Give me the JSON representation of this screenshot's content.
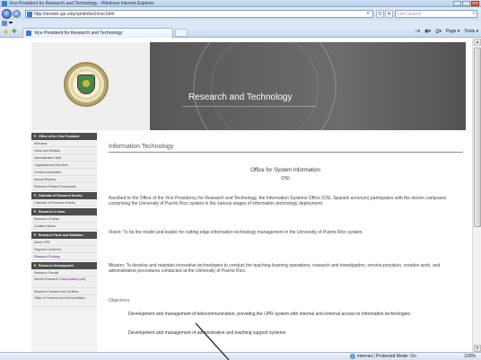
{
  "window": {
    "title": "Vice President for Research and Technology - Windows Internet Explorer"
  },
  "addressbar": {
    "url": "http://ierweb.upr.edu/vprit/eltech/osi.html",
    "back_icon": "back-arrow-icon",
    "forward_icon": "forward-arrow-icon"
  },
  "search": {
    "placeholder": "Live Search"
  },
  "tabs": [
    {
      "label": "Vice President for Research and Technology"
    }
  ],
  "toolbar": {
    "home": "▾",
    "feeds": "▾",
    "print": "▾",
    "page": "Page ▾",
    "tools": "Tools ▾"
  },
  "banner": {
    "title": "Research and Technology"
  },
  "sidebar": {
    "sections": [
      {
        "header": "Office of the Vice President",
        "items": [
          "Welcome",
          "Vision and Mission",
          "Administrative Staff",
          "Organizational Structure",
          "Contact Information",
          "Annual Reports",
          "Research Related Documents"
        ]
      },
      {
        "header": "Calendar of Research Events",
        "items": [
          "Calendar of Research Events"
        ]
      },
      {
        "header": "Research & News",
        "items": [
          "Research & News",
          "Creative Works"
        ]
      },
      {
        "header": "Research Facts and Statistics",
        "items": [
          "About UPR",
          "Degrees Conferred",
          "Research Funding"
        ]
      },
      {
        "header": "Research Development",
        "items": [
          "Research Faculty",
          "Recent Research Grant Awards (pdf)",
          "Research Centers and Facilities",
          "Office of Federal and External Affairs"
        ]
      }
    ]
  },
  "main": {
    "heading": "Information Technology",
    "office_title": "Office for System Information",
    "office_abbr": "OSI",
    "paragraph1": "Ascribed to the Office of the Vice Presidency for Research and Technology, the Information Systems Office (OSI, Spanish acronym) participates with the eleven campuses comprising the University of Puerto Rico system in the various stages of information technology deployment.",
    "paragraph2": "Vision: To be the model and leader for cutting edge information technology management in the University of Puerto Rico system.",
    "paragraph3": "Mission: To develop and maintain innovative technologies to conduct the teaching-learning operations, research and investigation, service-provision, creative work, and administrative procedures conducted at the University of Puerto Rico.",
    "objectives_heading": "Objectives",
    "objectives": [
      "Development and management of telecommunication, providing the UPR system with internal and external access to information technologies",
      "Development and management of administrative and teaching support systems"
    ]
  },
  "statusbar": {
    "zone": "Internet | Protected Mode: On",
    "zoom": "100%"
  }
}
